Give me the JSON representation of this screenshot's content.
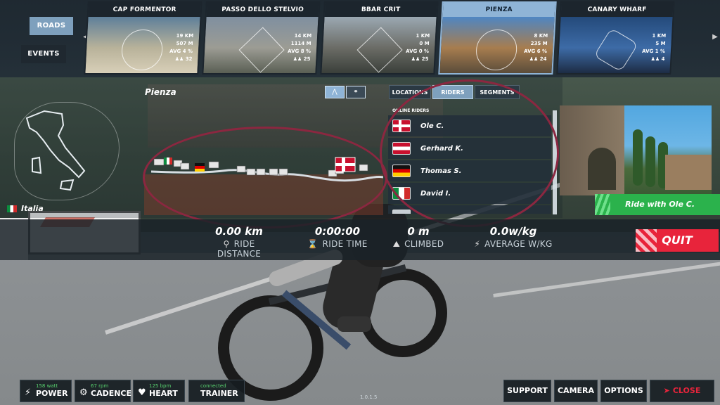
{
  "nav": {
    "roads_label": "ROADS",
    "events_label": "EVENTS"
  },
  "routes": [
    {
      "title": "CAP FORMENTOR",
      "distance": "19 KM",
      "elevation": "507 M",
      "avg_grade": "AVG 4 %",
      "riders": "32",
      "emblem": "circle",
      "photo_colors": [
        "#5e7f9a",
        "#b8b29a",
        "#d8cfb8"
      ]
    },
    {
      "title": "PASSO DELLO STELVIO",
      "distance": "14 KM",
      "elevation": "1114 M",
      "avg_grade": "AVG 8 %",
      "riders": "25",
      "emblem": "diamond",
      "photo_colors": [
        "#7f8fa0",
        "#9c9c94",
        "#5a5f54"
      ]
    },
    {
      "title": "BBAR CRIT",
      "distance": "1 KM",
      "elevation": "0 M",
      "avg_grade": "AVG 0 %",
      "riders": "25",
      "emblem": "diamond",
      "photo_colors": [
        "#9ba8b2",
        "#6b6c66",
        "#3a3f3a"
      ]
    },
    {
      "title": "PIENZA",
      "distance": "8 KM",
      "elevation": "235 M",
      "avg_grade": "AVG 6 %",
      "riders": "24",
      "emblem": "circle",
      "photo_colors": [
        "#4f86c2",
        "#a77d4f",
        "#5a4c3a"
      ],
      "active": true
    },
    {
      "title": "CANARY WHARF",
      "distance": "1 KM",
      "elevation": "5 M",
      "avg_grade": "AVG 1 %",
      "riders": "4",
      "emblem": "hex",
      "photo_colors": [
        "#244a7a",
        "#3d6ba6",
        "#1d2c44"
      ]
    }
  ],
  "route_detail": {
    "name": "Pienza",
    "country": "Italia",
    "country_flag": "flag-it"
  },
  "panel_tabs": {
    "locations": "LOCATIONS",
    "riders": "RIDERS",
    "segments": "SEGMENTS"
  },
  "riders_panel": {
    "title": "ONLINE RIDERS",
    "riders": [
      {
        "name": "Ole C.",
        "flag": "flag-dk"
      },
      {
        "name": "Gerhard K.",
        "flag": "flag-at"
      },
      {
        "name": "Thomas S.",
        "flag": "flag-de"
      },
      {
        "name": "David I.",
        "flag": "flag-it"
      }
    ]
  },
  "ride_with_label": "Ride with Ole C.",
  "stats": {
    "distance_value": "0.00 km",
    "distance_label": "RIDE DISTANCE",
    "time_value": "0:00:00",
    "time_label": "RIDE TIME",
    "climbed_value": "0 m",
    "climbed_label": "CLIMBED",
    "wkg_value": "0.0w/kg",
    "wkg_label": "AVERAGE W/KG"
  },
  "quit_label": "QUIT",
  "sensors": {
    "power_value": "158 watt",
    "power_label": "POWER",
    "cadence_value": "67 rpm",
    "cadence_label": "CADENCE",
    "heart_value": "125 bpm",
    "heart_label": "HEART",
    "trainer_value": "connected",
    "trainer_label": "TRAINER"
  },
  "actions": {
    "support": "SUPPORT",
    "camera": "CAMERA",
    "options": "OPTIONS",
    "close": "CLOSE"
  },
  "version": "1.0.1.5",
  "colors": {
    "accent_blue": "#8fb4d6",
    "quit_red": "#e8243b",
    "ride_green": "#2bb24c",
    "highlight_ellipse": "#8b2740"
  }
}
